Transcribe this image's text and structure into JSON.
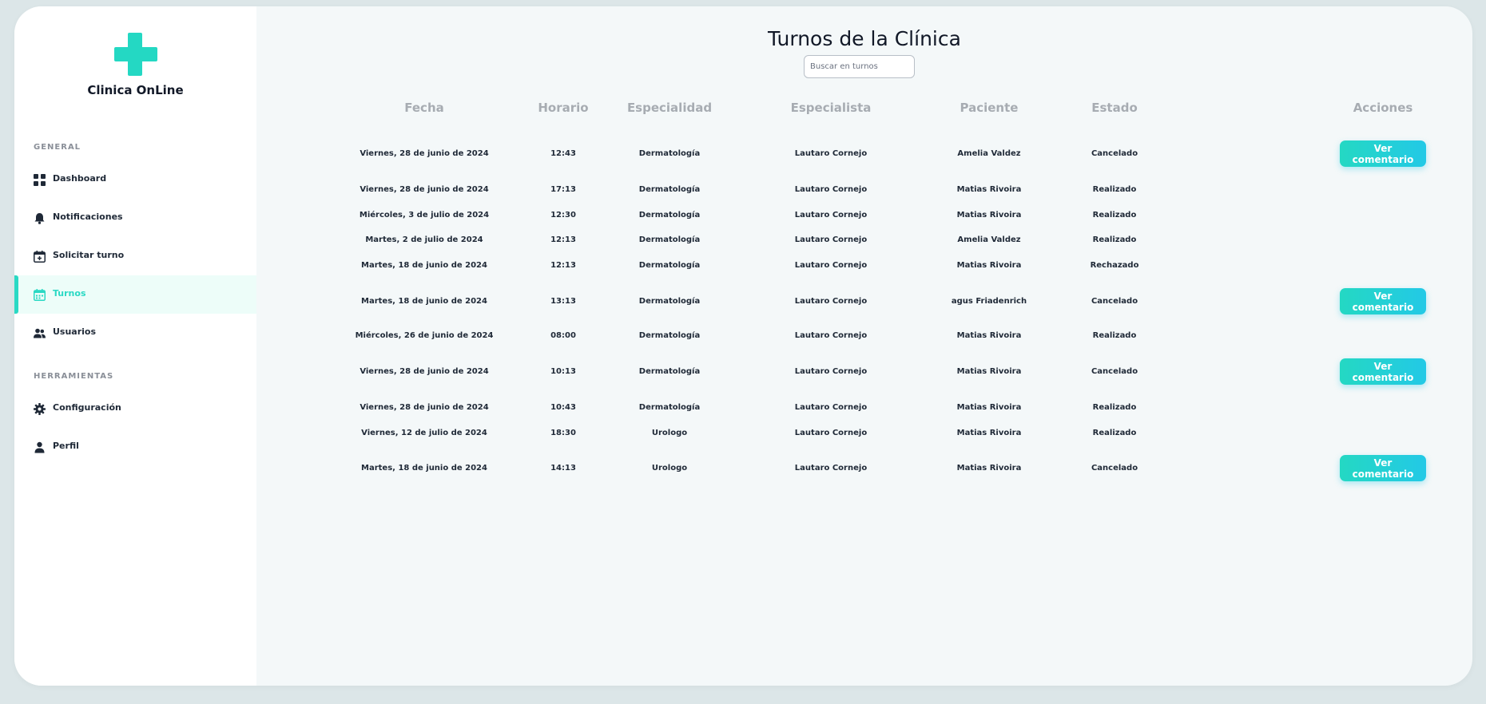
{
  "app": {
    "name": "Clinica OnLine"
  },
  "sidebar": {
    "section_general": "GENERAL",
    "section_tools": "HERRAMIENTAS",
    "items": [
      {
        "label": "Dashboard",
        "icon": "grid-icon"
      },
      {
        "label": "Notificaciones",
        "icon": "bell-icon"
      },
      {
        "label": "Solicitar turno",
        "icon": "calendar-plus-icon"
      },
      {
        "label": "Turnos",
        "icon": "calendar-icon",
        "active": true
      },
      {
        "label": "Usuarios",
        "icon": "users-icon"
      },
      {
        "label": "Configuración",
        "icon": "gear-icon"
      },
      {
        "label": "Perfil",
        "icon": "person-icon"
      }
    ]
  },
  "main": {
    "title": "Turnos de la Clínica",
    "search_placeholder": "Buscar en turnos",
    "columns": [
      "Fecha",
      "Horario",
      "Especialidad",
      "Especialista",
      "Paciente",
      "Estado",
      "Acciones"
    ],
    "action_label": "Ver comentario",
    "rows": [
      {
        "fecha": "Viernes, 28 de junio de 2024",
        "horario": "12:43",
        "especialidad": "Dermatología",
        "especialista": "Lautaro Cornejo",
        "paciente": "Amelia Valdez",
        "estado": "Cancelado",
        "accion": "Ver comentario"
      },
      {
        "fecha": "Viernes, 28 de junio de 2024",
        "horario": "17:13",
        "especialidad": "Dermatología",
        "especialista": "Lautaro Cornejo",
        "paciente": "Matias Rivoira",
        "estado": "Realizado",
        "accion": ""
      },
      {
        "fecha": "Miércoles, 3 de julio de 2024",
        "horario": "12:30",
        "especialidad": "Dermatología",
        "especialista": "Lautaro Cornejo",
        "paciente": "Matias Rivoira",
        "estado": "Realizado",
        "accion": ""
      },
      {
        "fecha": "Martes, 2 de julio de 2024",
        "horario": "12:13",
        "especialidad": "Dermatología",
        "especialista": "Lautaro Cornejo",
        "paciente": "Amelia Valdez",
        "estado": "Realizado",
        "accion": ""
      },
      {
        "fecha": "Martes, 18 de junio de 2024",
        "horario": "12:13",
        "especialidad": "Dermatología",
        "especialista": "Lautaro Cornejo",
        "paciente": "Matias Rivoira",
        "estado": "Rechazado",
        "accion": ""
      },
      {
        "fecha": "Martes, 18 de junio de 2024",
        "horario": "13:13",
        "especialidad": "Dermatología",
        "especialista": "Lautaro Cornejo",
        "paciente": "agus Friadenrich",
        "estado": "Cancelado",
        "accion": "Ver comentario"
      },
      {
        "fecha": "Miércoles, 26 de junio de 2024",
        "horario": "08:00",
        "especialidad": "Dermatología",
        "especialista": "Lautaro Cornejo",
        "paciente": "Matias Rivoira",
        "estado": "Realizado",
        "accion": ""
      },
      {
        "fecha": "Viernes, 28 de junio de 2024",
        "horario": "10:13",
        "especialidad": "Dermatología",
        "especialista": "Lautaro Cornejo",
        "paciente": "Matias Rivoira",
        "estado": "Cancelado",
        "accion": "Ver comentario"
      },
      {
        "fecha": "Viernes, 28 de junio de 2024",
        "horario": "10:43",
        "especialidad": "Dermatología",
        "especialista": "Lautaro Cornejo",
        "paciente": "Matias Rivoira",
        "estado": "Realizado",
        "accion": ""
      },
      {
        "fecha": "Viernes, 12 de julio de 2024",
        "horario": "18:30",
        "especialidad": "Urologo",
        "especialista": "Lautaro Cornejo",
        "paciente": "Matias Rivoira",
        "estado": "Realizado",
        "accion": ""
      },
      {
        "fecha": "Martes, 18 de junio de 2024",
        "horario": "14:13",
        "especialidad": "Urologo",
        "especialista": "Lautaro Cornejo",
        "paciente": "Matias Rivoira",
        "estado": "Cancelado",
        "accion": "Ver comentario"
      }
    ]
  },
  "colors": {
    "accent": "#2ad9c4",
    "accent_alt": "#23c9e6",
    "text_dark": "#111827",
    "header_gray": "#a7acb2"
  }
}
